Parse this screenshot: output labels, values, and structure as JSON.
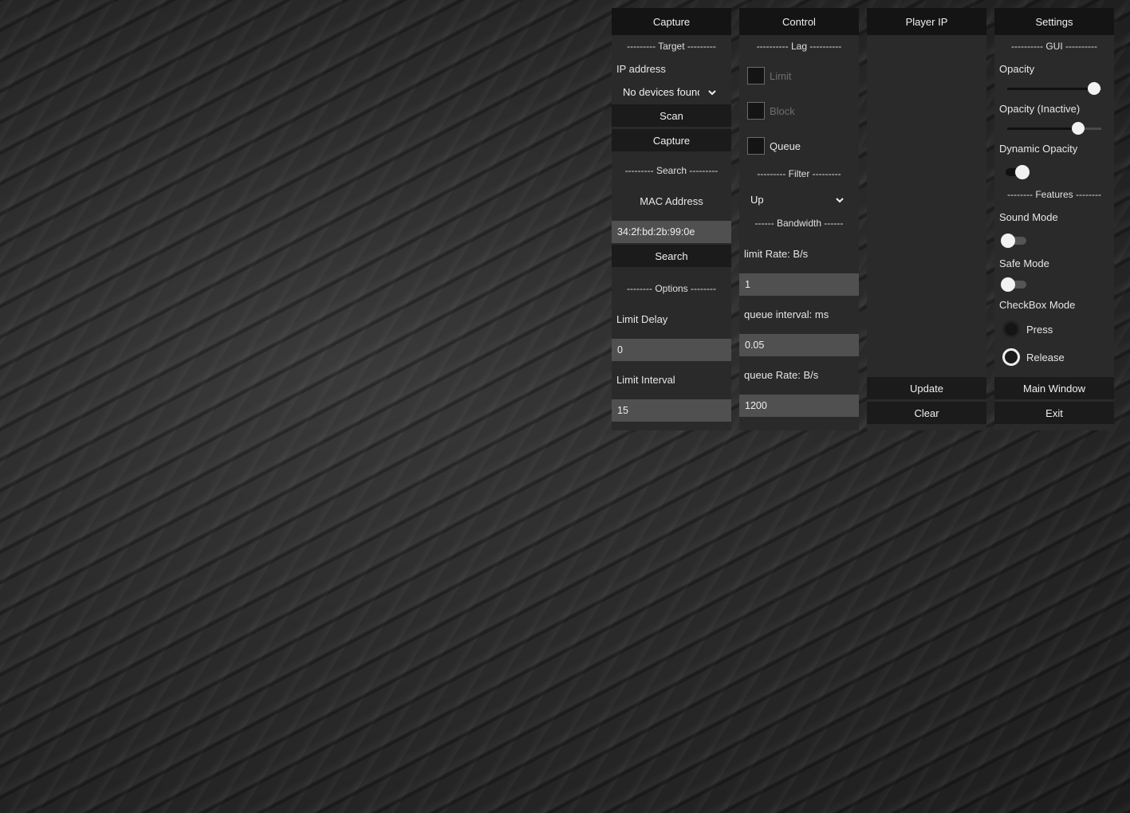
{
  "colors": {
    "panel_bg": "#2a2a2a",
    "title_bg": "#141414",
    "button_bg": "#1b1b1b",
    "field_bg": "#505050",
    "text": "#e6e6e6",
    "disabled_text": "#6e6e6e",
    "toggle_on_track": "#111111",
    "toggle_off_track": "#555555"
  },
  "capture": {
    "title": "Capture",
    "target_sep": "--------- Target ---------",
    "ip_label": "IP address",
    "ip_select": "No devices found",
    "scan_button": "Scan",
    "capture_button": "Capture",
    "search_sep": "--------- Search ---------",
    "mac_label": "MAC Address",
    "mac_value": "34:2f:bd:2b:99:0e",
    "search_button": "Search",
    "options_sep": "-------- Options --------",
    "delay_label": "Limit Delay",
    "delay_value": "0",
    "interval_label": "Limit Interval",
    "interval_value": "15"
  },
  "control": {
    "title": "Control",
    "lag_sep": "---------- Lag ----------",
    "limit_label": "Limit",
    "limit_checked": false,
    "block_label": "Block",
    "block_checked": false,
    "queue_label": "Queue",
    "queue_checked": false,
    "filter_sep": "--------- Filter ---------",
    "filter_value": "Up",
    "bandwidth_sep": "------ Bandwidth ------",
    "limit_rate_label": "limit Rate: B/s",
    "limit_rate_value": "1",
    "queue_interval_label": "queue interval: ms",
    "queue_interval_value": "0.05",
    "queue_rate_label": "queue Rate: B/s",
    "queue_rate_value": "1200"
  },
  "player_ip": {
    "title": "Player IP",
    "update_button": "Update",
    "clear_button": "Clear"
  },
  "settings": {
    "title": "Settings",
    "gui_sep": "---------- GUI ----------",
    "opacity_label": "Opacity",
    "opacity_value": 0.92,
    "opacity_inactive_label": "Opacity (Inactive)",
    "opacity_inactive_value": 0.75,
    "dynamic_opacity_label": "Dynamic Opacity",
    "dynamic_opacity_on": true,
    "features_sep": "-------- Features --------",
    "sound_mode_label": "Sound Mode",
    "sound_mode_on": false,
    "safe_mode_label": "Safe Mode",
    "safe_mode_on": false,
    "checkbox_mode_label": "CheckBox Mode",
    "press_label": "Press",
    "release_label": "Release",
    "checkbox_mode_selected": "Release",
    "main_window_button": "Main Window",
    "exit_button": "Exit"
  }
}
